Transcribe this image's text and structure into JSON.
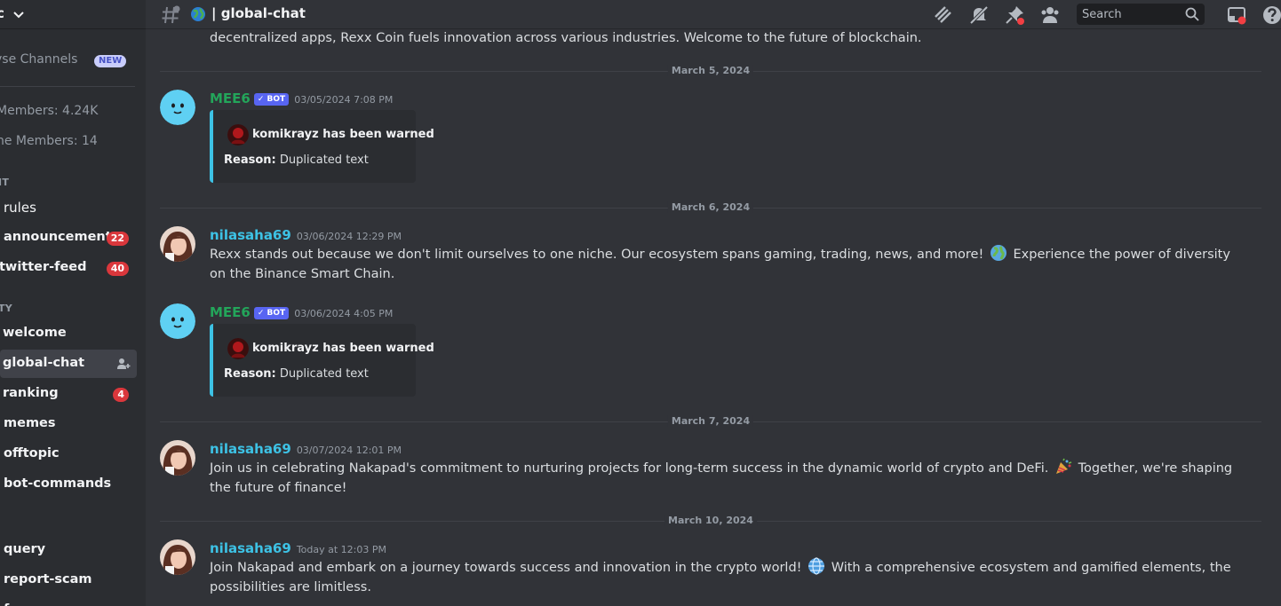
{
  "server": {
    "name": "c"
  },
  "sidebar": {
    "browse_label": "vse Channels",
    "browse_badge": "NEW",
    "members_label": "Members: 4.24K",
    "online_label": "ne Members: 14",
    "categories": [
      "IT",
      "TY"
    ],
    "channels": [
      {
        "label": "rules",
        "state": "muted"
      },
      {
        "label": "announcement",
        "state": "unread",
        "mentions": "22"
      },
      {
        "label": "twitter-feed",
        "state": "unread",
        "mentions": "40"
      },
      {
        "label": "welcome",
        "state": "unread"
      },
      {
        "label": "global-chat",
        "state": "active"
      },
      {
        "label": "ranking",
        "state": "unread",
        "mentions": "4"
      },
      {
        "label": "memes",
        "state": "unread"
      },
      {
        "label": "offtopic",
        "state": "unread"
      },
      {
        "label": "bot-commands",
        "state": "unread"
      },
      {
        "label": "query",
        "state": "unread"
      },
      {
        "label": "report-scam",
        "state": "unread"
      },
      {
        "label": "f",
        "state": "unread"
      }
    ]
  },
  "header": {
    "channel": "| global-chat",
    "search_placeholder": "Search",
    "icons": [
      "threads-icon",
      "mute-bell-icon",
      "pin-icon",
      "members-icon",
      "inbox-icon",
      "help-icon"
    ]
  },
  "messages": {
    "top_partial": "decentralized apps, Rexx Coin fuels innovation across various industries. Welcome to the future of blockchain.",
    "dates": [
      "March 5, 2024",
      "March 6, 2024",
      "March 7, 2024",
      "March 10, 2024"
    ],
    "items": [
      {
        "author": "MEE6",
        "bot_tag": "BOT",
        "timestamp": "03/05/2024 7:08 PM",
        "embed_title": "komikrayz has been warned",
        "embed_reason_label": "Reason:",
        "embed_reason": "Duplicated text"
      },
      {
        "author": "nilasaha69",
        "timestamp": "03/06/2024 12:29 PM",
        "text_a": "Rexx stands out because we don't limit ourselves to one niche. Our ecosystem spans gaming, trading, news, and more!",
        "text_b": "Experience the power of diversity on the Binance Smart Chain."
      },
      {
        "author": "MEE6",
        "bot_tag": "BOT",
        "timestamp": "03/06/2024 4:05 PM",
        "embed_title": "komikrayz has been warned",
        "embed_reason_label": "Reason:",
        "embed_reason": "Duplicated text"
      },
      {
        "author": "nilasaha69",
        "timestamp": "03/07/2024 12:01 PM",
        "text_a": "Join us in celebrating Nakapad's commitment to nurturing projects for long-term success in the dynamic world of crypto and DeFi.",
        "text_b": "Together, we're shaping the future of finance!"
      },
      {
        "author": "nilasaha69",
        "timestamp": "Today at 12:03 PM",
        "text_a": "Join Nakapad and embark on a journey towards success and innovation in the crypto world!",
        "text_b": "With a comprehensive ecosystem and gamified elements, the possibilities are limitless."
      }
    ]
  },
  "colors": {
    "bot_name": "#23a55a",
    "user_name": "#3dc2e5",
    "mention_badge": "#da373c",
    "bot_tag": "#5865f2"
  }
}
